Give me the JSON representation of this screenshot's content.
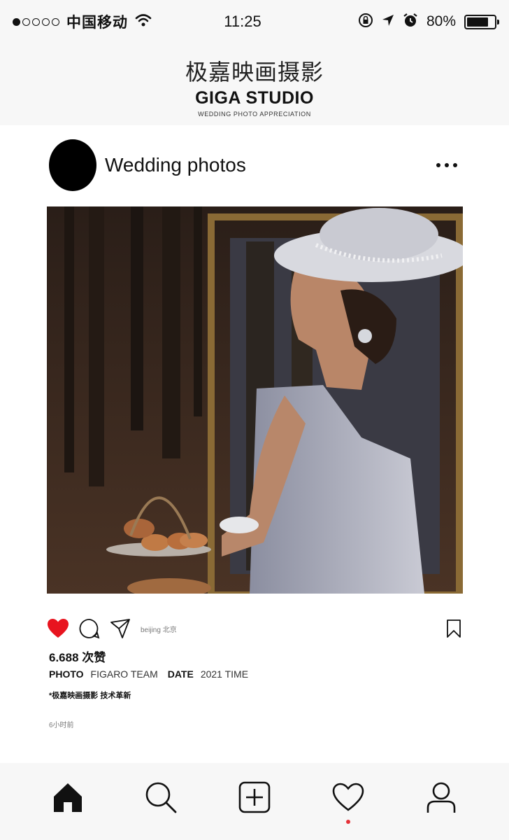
{
  "status_bar": {
    "carrier": "中国移动",
    "time": "11:25",
    "battery": "80%",
    "battery_level": 0.8,
    "signal_bars": 1,
    "signal_total": 5
  },
  "brand": {
    "title_cn": "极嘉映画摄影",
    "title_en": "GIGA STUDIO",
    "subtitle": "WEDDING PHOTO APPRECIATION"
  },
  "post": {
    "title": "Wedding photos",
    "location": "beijing 北京",
    "likes": "6.688 次赞",
    "photo_label": "PHOTO",
    "photo_value": "FIGARO TEAM",
    "date_label": "DATE",
    "date_value": "2021 TIME",
    "tagline": "*极嘉映画摄影 技术革新",
    "time_ago": "6小时前"
  },
  "colors": {
    "liked": "#e8141f",
    "accent_dot": "#e53238"
  },
  "icons": {
    "actions": [
      "heart-filled-icon",
      "comment-icon",
      "send-icon",
      "bookmark-icon"
    ],
    "tabs": [
      "home-icon",
      "search-icon",
      "add-icon",
      "heart-icon",
      "profile-icon"
    ]
  }
}
